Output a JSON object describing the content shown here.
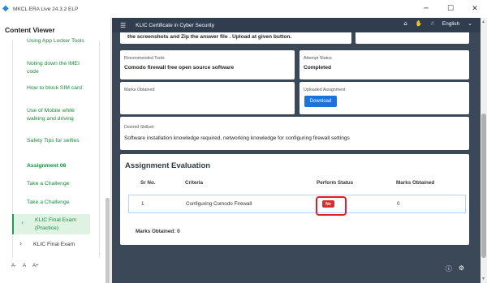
{
  "window": {
    "title": "MKCL ERA Live 24.3.2 ELP",
    "controls": {
      "minimize": "─",
      "maximize": "☐",
      "close": "✕"
    }
  },
  "sidebar": {
    "title": "Content Viewer",
    "items": [
      {
        "label": "Using App Locker Tools",
        "style": "normal"
      },
      {
        "label": "Noting down the IMEI code",
        "style": "normal"
      },
      {
        "label": "How to block SIM card",
        "style": "normal"
      },
      {
        "label": "Use of Mobile while walking and driving",
        "style": "normal"
      },
      {
        "label": "Safety Tips for selfies",
        "style": "normal"
      },
      {
        "label": "Assignment 06",
        "style": "bold"
      },
      {
        "label": "Take a Challenge",
        "style": "normal"
      },
      {
        "label": "Take a Challenge",
        "style": "normal"
      }
    ],
    "active_item": {
      "label": "KLIC Final Exam (Practice)"
    },
    "last_item": {
      "label": "KLIC Final Exam"
    },
    "font_controls": [
      "A-",
      "A",
      "A+"
    ]
  },
  "topnav": {
    "title": "KLIC Certificate in Cyber Security",
    "language": "English"
  },
  "details": {
    "instructions_tail": "the screenshots and Zip the answer file . Upload at given button.",
    "recommended_tools_label": "Recommended Tools",
    "recommended_tools_value": "Comodo firewall free open source software",
    "attempt_status_label": "Attempt Status",
    "attempt_status_value": "Completed",
    "marks_obtained_label": "Marks Obtained",
    "uploaded_assignment_label": "Uploaded Assignment",
    "download_button": "Download",
    "desired_skillset_label": "Desired Skillset",
    "desired_skillset_value": "Software installation knowledge required, networking knowledge for configuring firewall settings"
  },
  "evaluation": {
    "title": "Assignment Evaluation",
    "columns": [
      "Sr No.",
      "Criteria",
      "Perform Status",
      "Marks Obtained"
    ],
    "rows": [
      {
        "sr": "1",
        "criteria": "Configuring Comodo Firewall",
        "status": "No",
        "marks": "0"
      }
    ],
    "total_label": "Marks Obtained: 0"
  },
  "colors": {
    "header_bg": "#2f3d4e",
    "accent_green": "#1a8a3a",
    "download_blue": "#1e73d8",
    "status_red": "#d62f2f"
  }
}
